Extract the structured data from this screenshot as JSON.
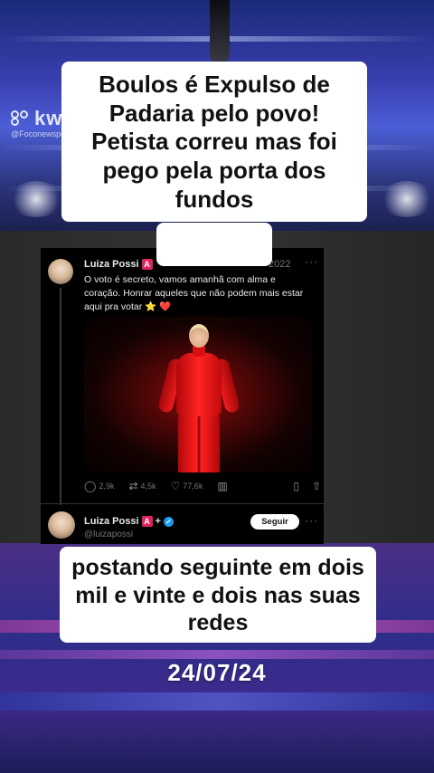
{
  "watermark": {
    "brand": "kwai",
    "handle": "@Foconewspolitica",
    "logo_icon": "kwai-logo-icon"
  },
  "captions": {
    "top": "Boulos é Expulso de Padaria pelo povo! Petista correu mas foi pego pela porta dos fundos",
    "bottom": "postando seguinte em dois mil e vinte e dois nas suas redes",
    "date": "24/07/24"
  },
  "tweet": {
    "author": "Luiza Possi",
    "badge": "A",
    "year": "2022",
    "more": "···",
    "text": "O voto é secreto, vamos amanhã com alma e coração. Honrar aqueles que não podem mais estar aqui pra votar",
    "emojis": {
      "star": "⭐",
      "heart": "❤️"
    },
    "stats": {
      "replies": "2,9k",
      "retweets": "4,5k",
      "likes": "77,6k"
    },
    "icons": [
      "reply-icon",
      "retweet-icon",
      "like-icon",
      "views-icon",
      "bookmark-icon",
      "share-icon"
    ]
  },
  "profile": {
    "name": "Luiza Possi",
    "badge": "A",
    "plus": "+",
    "handle": "@luizapossi",
    "follow_label": "Seguir",
    "more": "···"
  },
  "colors": {
    "caption_bg": "#ffffff",
    "tweet_bg": "#000000",
    "verified": "#1d9bf0",
    "badge": "#e0245e"
  }
}
